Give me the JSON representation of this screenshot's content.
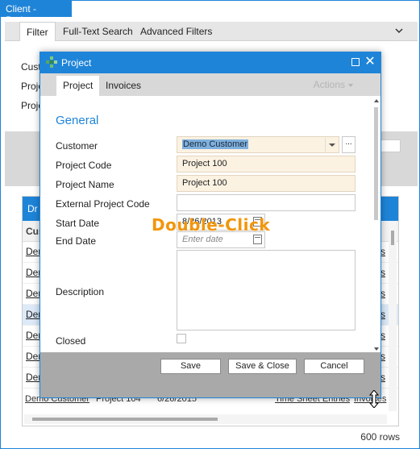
{
  "window": {
    "title": "Client - Projects"
  },
  "outer_tabs": [
    "Filter",
    "Full-Text Search",
    "Advanced Filters"
  ],
  "background": {
    "labels": [
      "Cust",
      "Proje",
      "Proje"
    ],
    "grid_header": "Dr",
    "grid_col": "Cus",
    "row_prefix": "Dem",
    "row_suffix": "s",
    "last_row": {
      "customer": "Demo Customer",
      "project": "Project 104",
      "date": "6/26/2015",
      "time_entries": "Time Sheet Entries",
      "invoices": "Invoices"
    },
    "rows_count": "600 rows"
  },
  "dialog": {
    "title": "Project",
    "tabs": [
      "Project",
      "Invoices"
    ],
    "actions_label": "Actions",
    "section_title": "General",
    "fields": {
      "customer": {
        "label": "Customer",
        "value": "Demo Customer"
      },
      "project_code": {
        "label": "Project Code",
        "value": "Project 100"
      },
      "project_name": {
        "label": "Project Name",
        "value": "Project 100"
      },
      "external_project_code": {
        "label": "External Project Code",
        "value": ""
      },
      "start_date": {
        "label": "Start Date",
        "value": "8/26/2013"
      },
      "end_date": {
        "label": "End Date",
        "placeholder": "Enter date"
      },
      "description": {
        "label": "Description",
        "value": ""
      },
      "closed": {
        "label": "Closed",
        "checked": false
      }
    },
    "buttons": {
      "save": "Save",
      "save_close": "Save & Close",
      "cancel": "Cancel"
    }
  },
  "overlay_text": "Double-Click"
}
